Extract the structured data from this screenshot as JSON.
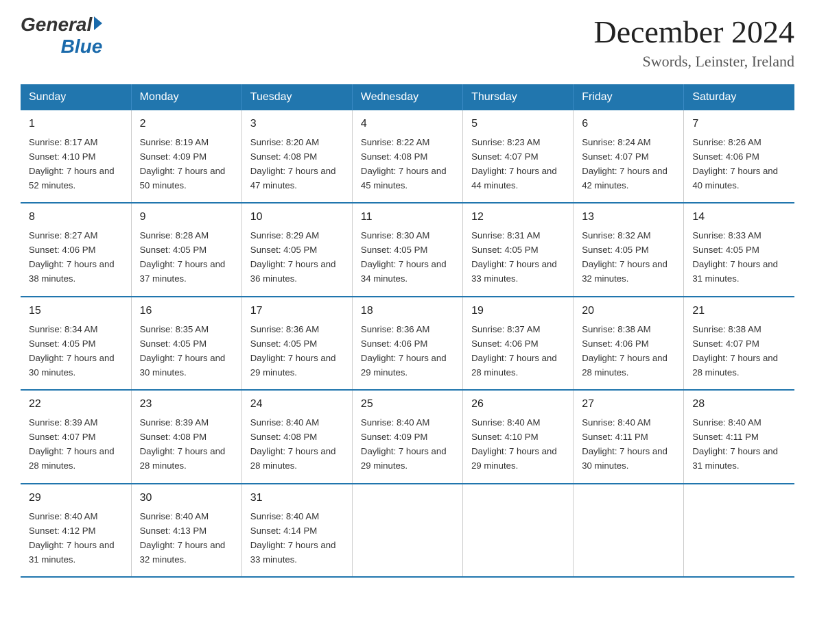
{
  "logo": {
    "general": "General",
    "blue": "Blue",
    "arrow": "▶"
  },
  "header": {
    "title": "December 2024",
    "location": "Swords, Leinster, Ireland"
  },
  "days_of_week": [
    "Sunday",
    "Monday",
    "Tuesday",
    "Wednesday",
    "Thursday",
    "Friday",
    "Saturday"
  ],
  "weeks": [
    [
      {
        "day": "1",
        "sunrise": "8:17 AM",
        "sunset": "4:10 PM",
        "daylight": "7 hours and 52 minutes."
      },
      {
        "day": "2",
        "sunrise": "8:19 AM",
        "sunset": "4:09 PM",
        "daylight": "7 hours and 50 minutes."
      },
      {
        "day": "3",
        "sunrise": "8:20 AM",
        "sunset": "4:08 PM",
        "daylight": "7 hours and 47 minutes."
      },
      {
        "day": "4",
        "sunrise": "8:22 AM",
        "sunset": "4:08 PM",
        "daylight": "7 hours and 45 minutes."
      },
      {
        "day": "5",
        "sunrise": "8:23 AM",
        "sunset": "4:07 PM",
        "daylight": "7 hours and 44 minutes."
      },
      {
        "day": "6",
        "sunrise": "8:24 AM",
        "sunset": "4:07 PM",
        "daylight": "7 hours and 42 minutes."
      },
      {
        "day": "7",
        "sunrise": "8:26 AM",
        "sunset": "4:06 PM",
        "daylight": "7 hours and 40 minutes."
      }
    ],
    [
      {
        "day": "8",
        "sunrise": "8:27 AM",
        "sunset": "4:06 PM",
        "daylight": "7 hours and 38 minutes."
      },
      {
        "day": "9",
        "sunrise": "8:28 AM",
        "sunset": "4:05 PM",
        "daylight": "7 hours and 37 minutes."
      },
      {
        "day": "10",
        "sunrise": "8:29 AM",
        "sunset": "4:05 PM",
        "daylight": "7 hours and 36 minutes."
      },
      {
        "day": "11",
        "sunrise": "8:30 AM",
        "sunset": "4:05 PM",
        "daylight": "7 hours and 34 minutes."
      },
      {
        "day": "12",
        "sunrise": "8:31 AM",
        "sunset": "4:05 PM",
        "daylight": "7 hours and 33 minutes."
      },
      {
        "day": "13",
        "sunrise": "8:32 AM",
        "sunset": "4:05 PM",
        "daylight": "7 hours and 32 minutes."
      },
      {
        "day": "14",
        "sunrise": "8:33 AM",
        "sunset": "4:05 PM",
        "daylight": "7 hours and 31 minutes."
      }
    ],
    [
      {
        "day": "15",
        "sunrise": "8:34 AM",
        "sunset": "4:05 PM",
        "daylight": "7 hours and 30 minutes."
      },
      {
        "day": "16",
        "sunrise": "8:35 AM",
        "sunset": "4:05 PM",
        "daylight": "7 hours and 30 minutes."
      },
      {
        "day": "17",
        "sunrise": "8:36 AM",
        "sunset": "4:05 PM",
        "daylight": "7 hours and 29 minutes."
      },
      {
        "day": "18",
        "sunrise": "8:36 AM",
        "sunset": "4:06 PM",
        "daylight": "7 hours and 29 minutes."
      },
      {
        "day": "19",
        "sunrise": "8:37 AM",
        "sunset": "4:06 PM",
        "daylight": "7 hours and 28 minutes."
      },
      {
        "day": "20",
        "sunrise": "8:38 AM",
        "sunset": "4:06 PM",
        "daylight": "7 hours and 28 minutes."
      },
      {
        "day": "21",
        "sunrise": "8:38 AM",
        "sunset": "4:07 PM",
        "daylight": "7 hours and 28 minutes."
      }
    ],
    [
      {
        "day": "22",
        "sunrise": "8:39 AM",
        "sunset": "4:07 PM",
        "daylight": "7 hours and 28 minutes."
      },
      {
        "day": "23",
        "sunrise": "8:39 AM",
        "sunset": "4:08 PM",
        "daylight": "7 hours and 28 minutes."
      },
      {
        "day": "24",
        "sunrise": "8:40 AM",
        "sunset": "4:08 PM",
        "daylight": "7 hours and 28 minutes."
      },
      {
        "day": "25",
        "sunrise": "8:40 AM",
        "sunset": "4:09 PM",
        "daylight": "7 hours and 29 minutes."
      },
      {
        "day": "26",
        "sunrise": "8:40 AM",
        "sunset": "4:10 PM",
        "daylight": "7 hours and 29 minutes."
      },
      {
        "day": "27",
        "sunrise": "8:40 AM",
        "sunset": "4:11 PM",
        "daylight": "7 hours and 30 minutes."
      },
      {
        "day": "28",
        "sunrise": "8:40 AM",
        "sunset": "4:11 PM",
        "daylight": "7 hours and 31 minutes."
      }
    ],
    [
      {
        "day": "29",
        "sunrise": "8:40 AM",
        "sunset": "4:12 PM",
        "daylight": "7 hours and 31 minutes."
      },
      {
        "day": "30",
        "sunrise": "8:40 AM",
        "sunset": "4:13 PM",
        "daylight": "7 hours and 32 minutes."
      },
      {
        "day": "31",
        "sunrise": "8:40 AM",
        "sunset": "4:14 PM",
        "daylight": "7 hours and 33 minutes."
      },
      null,
      null,
      null,
      null
    ]
  ]
}
